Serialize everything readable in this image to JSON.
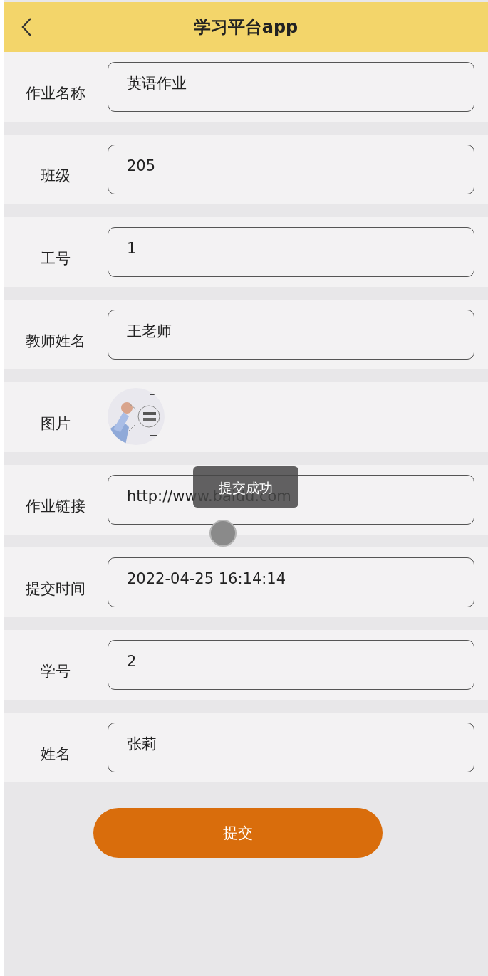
{
  "header": {
    "title": "学习平台app"
  },
  "rows": [
    {
      "kind": "field",
      "label": "作业名称",
      "value": "英语作业"
    },
    {
      "kind": "field",
      "label": "班级",
      "value": "205"
    },
    {
      "kind": "field",
      "label": "工号",
      "value": "1"
    },
    {
      "kind": "field",
      "label": "教师姓名",
      "value": "王老师"
    },
    {
      "label": "图片"
    },
    {
      "kind": "field",
      "label": "作业链接",
      "value": "http://www.baidu.com"
    },
    {
      "kind": "field",
      "label": "提交时间",
      "value": "2022-04-25 16:14:14"
    },
    {
      "kind": "field",
      "label": "学号",
      "value": "2"
    },
    {
      "kind": "field",
      "label": "姓名",
      "value": "张莉"
    }
  ],
  "submit_button": "提交",
  "toast": "提交成功"
}
